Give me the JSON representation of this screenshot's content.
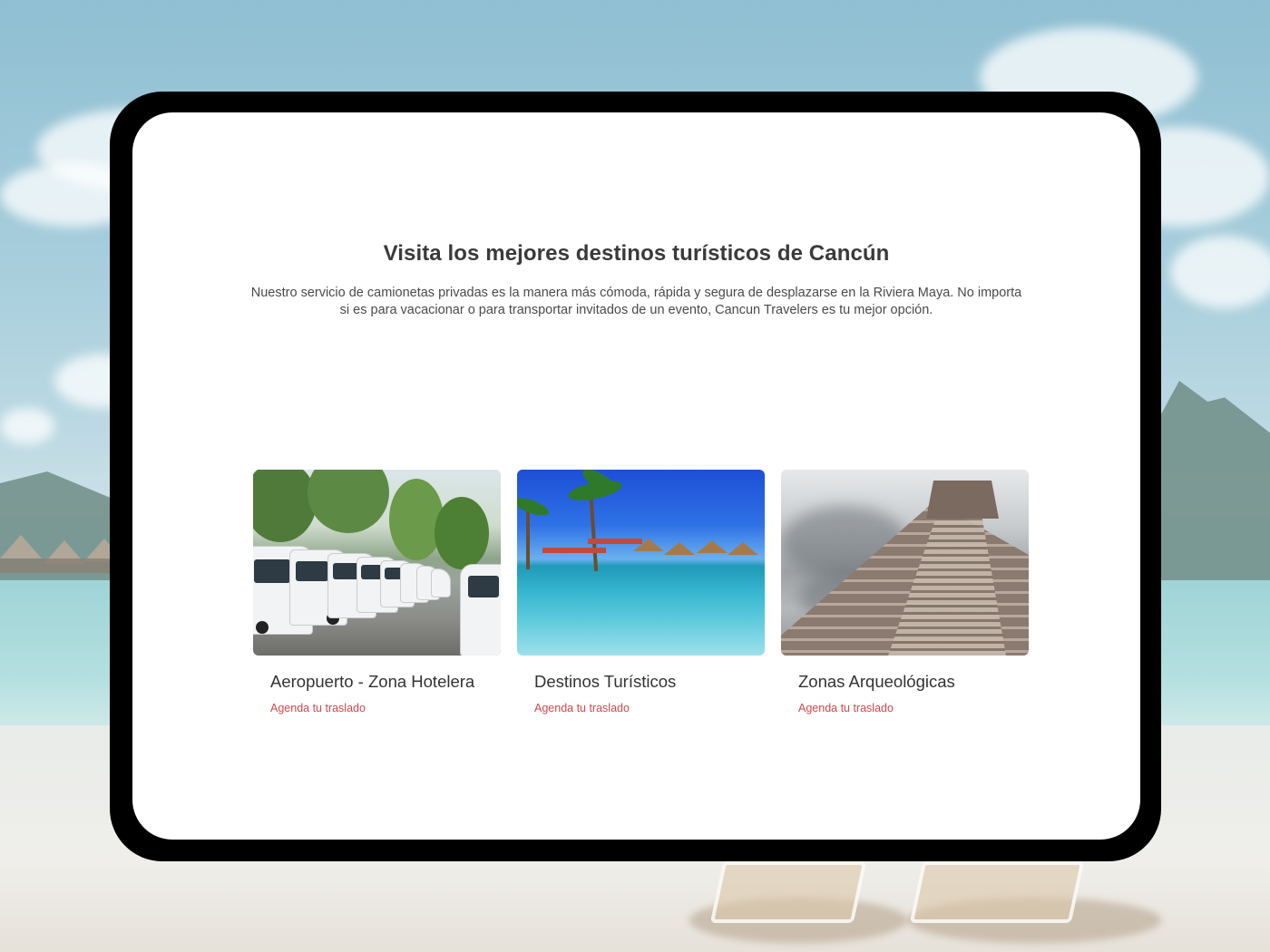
{
  "section": {
    "heading": "Visita los mejores destinos turísticos de Cancún",
    "intro_line1": "Nuestro servicio de camionetas privadas es la manera más cómoda, rápida y segura de desplazarse en la Riviera Maya. No importa",
    "intro_line2": "si es para vacacionar o para transportar invitados de un evento, Cancun Travelers es tu mejor opción."
  },
  "cards": [
    {
      "title": "Aeropuerto - Zona Hotelera",
      "link": "Agenda tu traslado",
      "image": "vans-parked-photo"
    },
    {
      "title": "Destinos Turísticos",
      "link": "Agenda tu traslado",
      "image": "beach-pool-photo"
    },
    {
      "title": "Zonas Arqueológicas",
      "link": "Agenda tu traslado",
      "image": "pyramid-photo"
    }
  ],
  "colors": {
    "link": "#d0474f",
    "heading": "#3a3a3a",
    "frame": "#000000",
    "screen": "#ffffff"
  }
}
